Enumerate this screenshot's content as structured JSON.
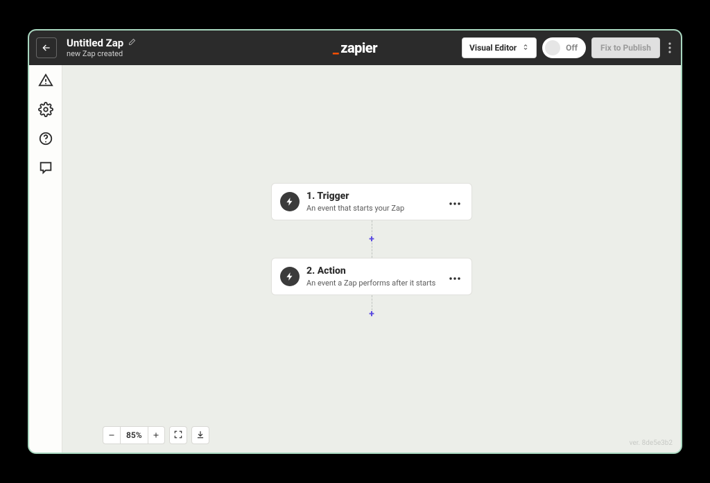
{
  "header": {
    "title": "Untitled Zap",
    "subtitle": "new Zap created",
    "editor_mode_label": "Visual Editor",
    "toggle_label": "Off",
    "publish_label": "Fix to Publish",
    "logo_text": "zapier"
  },
  "sidebar": {
    "items": [
      {
        "name": "alerts",
        "icon": "warning-icon"
      },
      {
        "name": "settings",
        "icon": "gear-icon"
      },
      {
        "name": "help",
        "icon": "help-icon"
      },
      {
        "name": "comments",
        "icon": "comment-icon"
      }
    ]
  },
  "flow": {
    "steps": [
      {
        "title": "1. Trigger",
        "description": "An event that starts your Zap"
      },
      {
        "title": "2. Action",
        "description": "An event a Zap performs after it starts"
      }
    ]
  },
  "zoom": {
    "percent_label": "85%"
  },
  "footer": {
    "version_label": "ver. 8de5e3b2"
  }
}
